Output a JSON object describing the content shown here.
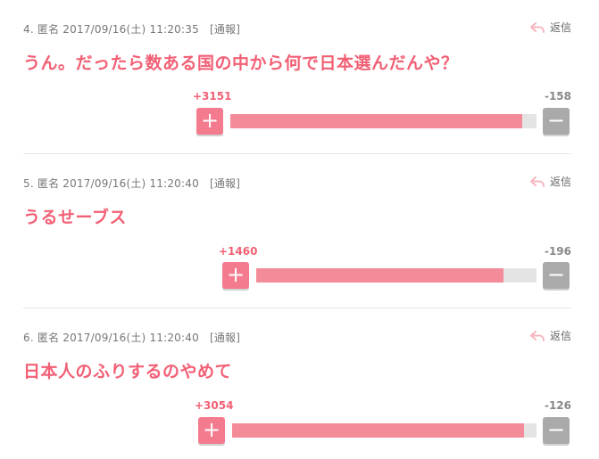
{
  "reply_label": "返信",
  "colors": {
    "accent": "#f26075",
    "plus_button": "#f47a8d",
    "minus_button": "#aaaaaa",
    "bar_fill": "#f48b99",
    "bar_track": "#e4e4e4"
  },
  "comments": [
    {
      "number": "4.",
      "author": "匿名",
      "timestamp": "2017/09/16(土) 11:20:35",
      "report": "[通報]",
      "text": "うん。だったら数ある国の中から何で日本選んだんや？",
      "plus": "+3151",
      "minus": "-158",
      "plus_ratio": 0.952
    },
    {
      "number": "5.",
      "author": "匿名",
      "timestamp": "2017/09/16(土) 11:20:40",
      "report": "[通報]",
      "text": "うるせーブス",
      "plus": "+1460",
      "minus": "-196",
      "plus_ratio": 0.882
    },
    {
      "number": "6.",
      "author": "匿名",
      "timestamp": "2017/09/16(土) 11:20:40",
      "report": "[通報]",
      "text": "日本人のふりするのやめて",
      "plus": "+3054",
      "minus": "-126",
      "plus_ratio": 0.96
    }
  ]
}
